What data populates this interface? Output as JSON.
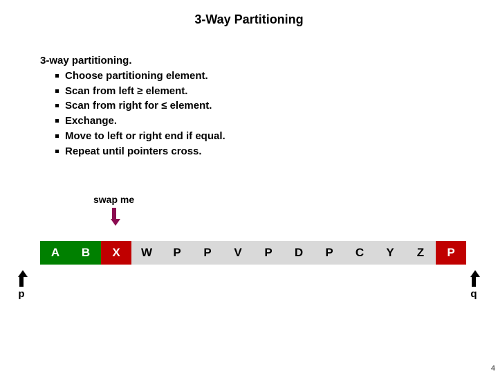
{
  "title": "3-Way Partitioning",
  "heading": "3-way partitioning.",
  "bullets": [
    "Choose partitioning element.",
    "Scan from left ≥ element.",
    "Scan from right for ≤  element.",
    "Exchange.",
    "Move to left or right end if equal.",
    "Repeat until pointers cross."
  ],
  "swap_label": "swap me",
  "cells": [
    {
      "v": "A",
      "c": "green"
    },
    {
      "v": "B",
      "c": "green"
    },
    {
      "v": "X",
      "c": "red"
    },
    {
      "v": "W",
      "c": "gray"
    },
    {
      "v": "P",
      "c": "gray"
    },
    {
      "v": "P",
      "c": "gray"
    },
    {
      "v": "V",
      "c": "gray"
    },
    {
      "v": "P",
      "c": "gray"
    },
    {
      "v": "D",
      "c": "gray"
    },
    {
      "v": "P",
      "c": "gray"
    },
    {
      "v": "C",
      "c": "gray"
    },
    {
      "v": "Y",
      "c": "gray"
    },
    {
      "v": "Z",
      "c": "gray"
    },
    {
      "v": "P",
      "c": "red"
    }
  ],
  "ptr_p": "p",
  "ptr_q": "q",
  "page": "4"
}
